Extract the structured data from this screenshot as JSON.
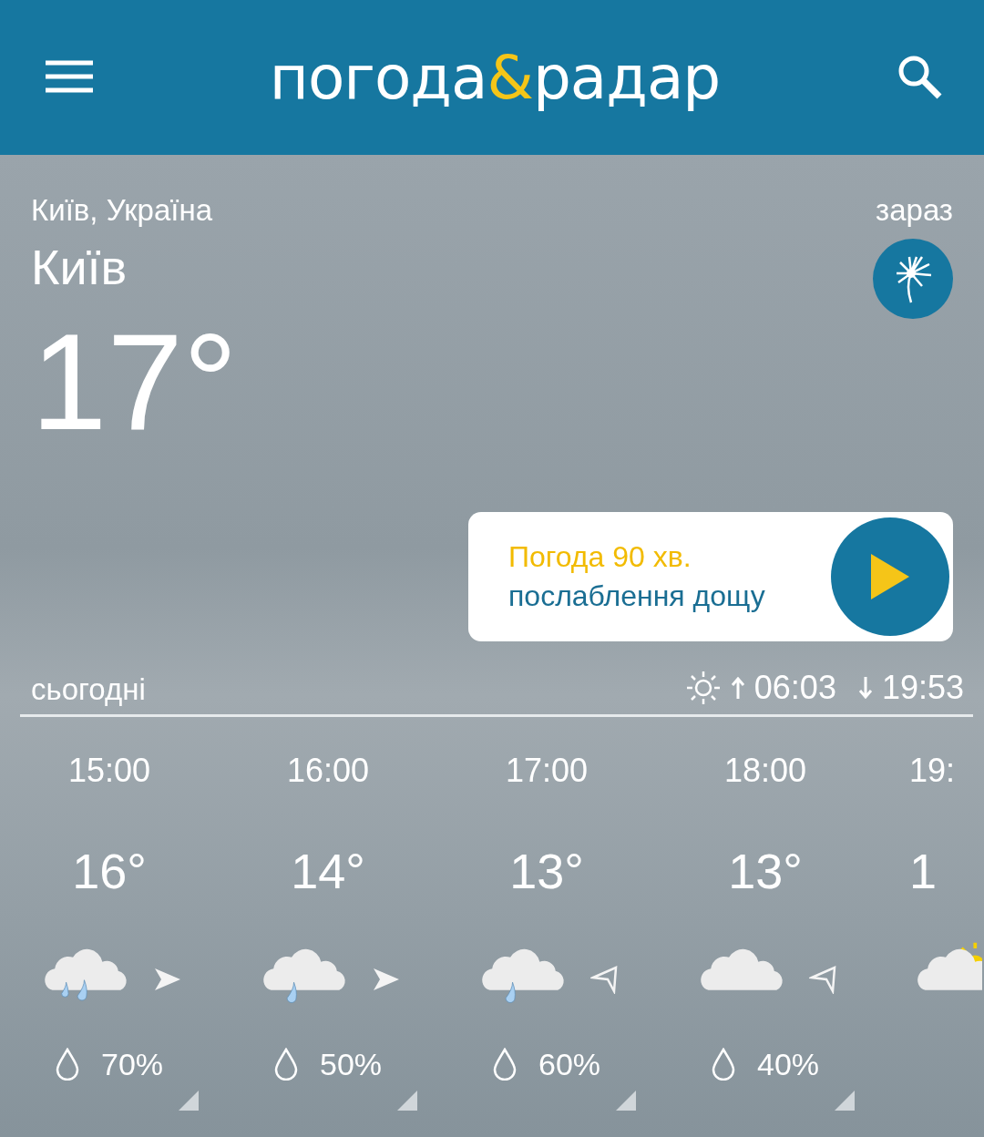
{
  "header": {
    "logo": {
      "left": "погода",
      "mark": "&",
      "right": "радар"
    }
  },
  "location": {
    "region": "Київ, Україна",
    "now_label": "зараз",
    "city": "Київ",
    "temperature": "17°"
  },
  "nowcast": {
    "title": "Погода 90 хв.",
    "subtitle": "послаблення дощу"
  },
  "today": {
    "label": "сьогодні",
    "sunrise": "06:03",
    "sunset": "19:53"
  },
  "hours": [
    {
      "time": "15:00",
      "temp": "16°",
      "kind": "rain-heavy",
      "wind": {
        "kind": "solid"
      },
      "precip": "70%"
    },
    {
      "time": "16:00",
      "temp": "14°",
      "kind": "rain",
      "wind": {
        "kind": "solid"
      },
      "precip": "50%"
    },
    {
      "time": "17:00",
      "temp": "13°",
      "kind": "rain",
      "wind": {
        "kind": "outline"
      },
      "precip": "60%"
    },
    {
      "time": "18:00",
      "temp": "13°",
      "kind": "cloud",
      "wind": {
        "kind": "outline"
      },
      "precip": "40%"
    },
    {
      "time": "19:",
      "temp": "1",
      "kind": "sun-cloud"
    }
  ]
}
